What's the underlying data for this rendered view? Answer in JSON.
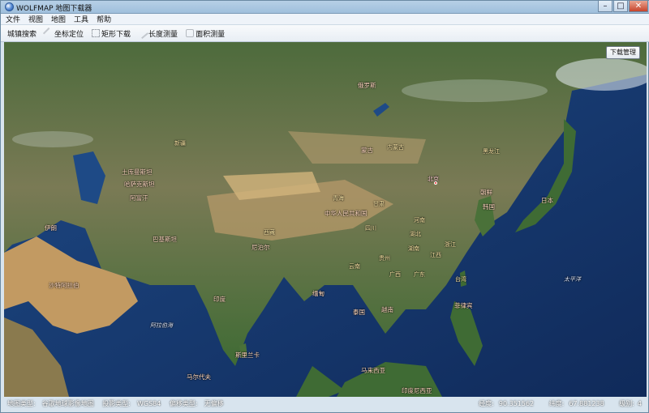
{
  "window": {
    "title": "WOLFMAP 地图下载器",
    "minimize_glyph": "–",
    "maximize_glyph": "□",
    "close_glyph": "✕"
  },
  "menu": [
    "文件",
    "视图",
    "地图",
    "工具",
    "帮助"
  ],
  "toolbar": {
    "items": [
      {
        "label": "城镇搜索",
        "icon": "search-icon"
      },
      {
        "label": "坐标定位",
        "icon": "pin-icon"
      },
      {
        "label": "矩形下载",
        "icon": "rectangle-icon"
      },
      {
        "label": "长度测量",
        "icon": "ruler-icon"
      },
      {
        "label": "面积测量",
        "icon": "area-icon"
      }
    ]
  },
  "download_manager_label": "下载管理",
  "map": {
    "labels": [
      {
        "text": "俄罗斯",
        "kind": "country"
      },
      {
        "text": "哈萨克斯坦",
        "kind": "country"
      },
      {
        "text": "蒙古",
        "kind": "country"
      },
      {
        "text": "中华人民共和国",
        "kind": "country"
      },
      {
        "text": "印度",
        "kind": "country"
      },
      {
        "text": "伊朗",
        "kind": "country"
      },
      {
        "text": "沙特阿拉伯",
        "kind": "country"
      },
      {
        "text": "巴基斯坦",
        "kind": "country"
      },
      {
        "text": "阿富汗",
        "kind": "country"
      },
      {
        "text": "土库曼斯坦",
        "kind": "country"
      },
      {
        "text": "缅甸",
        "kind": "country"
      },
      {
        "text": "泰国",
        "kind": "country"
      },
      {
        "text": "越南",
        "kind": "country"
      },
      {
        "text": "菲律宾",
        "kind": "country"
      },
      {
        "text": "马来西亚",
        "kind": "country"
      },
      {
        "text": "印度尼西亚",
        "kind": "country"
      },
      {
        "text": "日本",
        "kind": "country"
      },
      {
        "text": "韩国",
        "kind": "country"
      },
      {
        "text": "朝鲜",
        "kind": "country"
      },
      {
        "text": "尼泊尔",
        "kind": "country"
      },
      {
        "text": "北京",
        "kind": "capital"
      },
      {
        "text": "新疆",
        "kind": "province"
      },
      {
        "text": "西藏",
        "kind": "province"
      },
      {
        "text": "青海",
        "kind": "province"
      },
      {
        "text": "四川",
        "kind": "province"
      },
      {
        "text": "甘肃",
        "kind": "province"
      },
      {
        "text": "内蒙古",
        "kind": "province"
      },
      {
        "text": "黑龙江",
        "kind": "province"
      },
      {
        "text": "云南",
        "kind": "province"
      },
      {
        "text": "广东",
        "kind": "province"
      },
      {
        "text": "湖南",
        "kind": "province"
      },
      {
        "text": "湖北",
        "kind": "province"
      },
      {
        "text": "河南",
        "kind": "province"
      },
      {
        "text": "江西",
        "kind": "province"
      },
      {
        "text": "浙江",
        "kind": "province"
      },
      {
        "text": "广西",
        "kind": "province"
      },
      {
        "text": "贵州",
        "kind": "province"
      },
      {
        "text": "台湾",
        "kind": "province"
      },
      {
        "text": "太平洋",
        "kind": "sea"
      },
      {
        "text": "阿拉伯海",
        "kind": "sea"
      },
      {
        "text": "马尔代夫",
        "kind": "country"
      },
      {
        "text": "斯里兰卡",
        "kind": "country"
      }
    ]
  },
  "status": {
    "map_type_label": "地图类型:",
    "map_type_value": "谷歌地球影像地图",
    "projection_label": "投影类型:",
    "projection_value": "WGS84",
    "offset_label": "偏移类型:",
    "offset_value": "无偏移",
    "lon_label": "经度:",
    "lon_value": "90.351562",
    "lat_label": "纬度:",
    "lat_value": "67.881238",
    "level_label": "级别:",
    "level_value": "4"
  }
}
